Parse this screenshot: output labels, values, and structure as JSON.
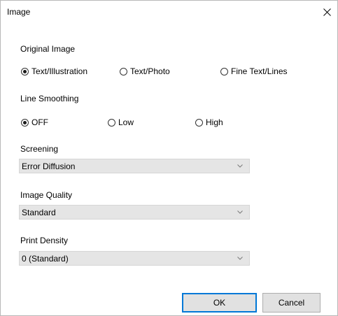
{
  "window": {
    "title": "Image",
    "close_icon": "close-icon"
  },
  "original_image": {
    "label": "Original Image",
    "options": [
      {
        "label": "Text/Illustration",
        "checked": true
      },
      {
        "label": "Text/Photo",
        "checked": false
      },
      {
        "label": "Fine Text/Lines",
        "checked": false
      }
    ]
  },
  "line_smoothing": {
    "label": "Line Smoothing",
    "options": [
      {
        "label": "OFF",
        "checked": true
      },
      {
        "label": "Low",
        "checked": false
      },
      {
        "label": "High",
        "checked": false
      }
    ]
  },
  "screening": {
    "label": "Screening",
    "value": "Error Diffusion"
  },
  "image_quality": {
    "label": "Image Quality",
    "value": "Standard"
  },
  "print_density": {
    "label": "Print Density",
    "value": "0 (Standard)"
  },
  "buttons": {
    "ok": "OK",
    "cancel": "Cancel"
  }
}
